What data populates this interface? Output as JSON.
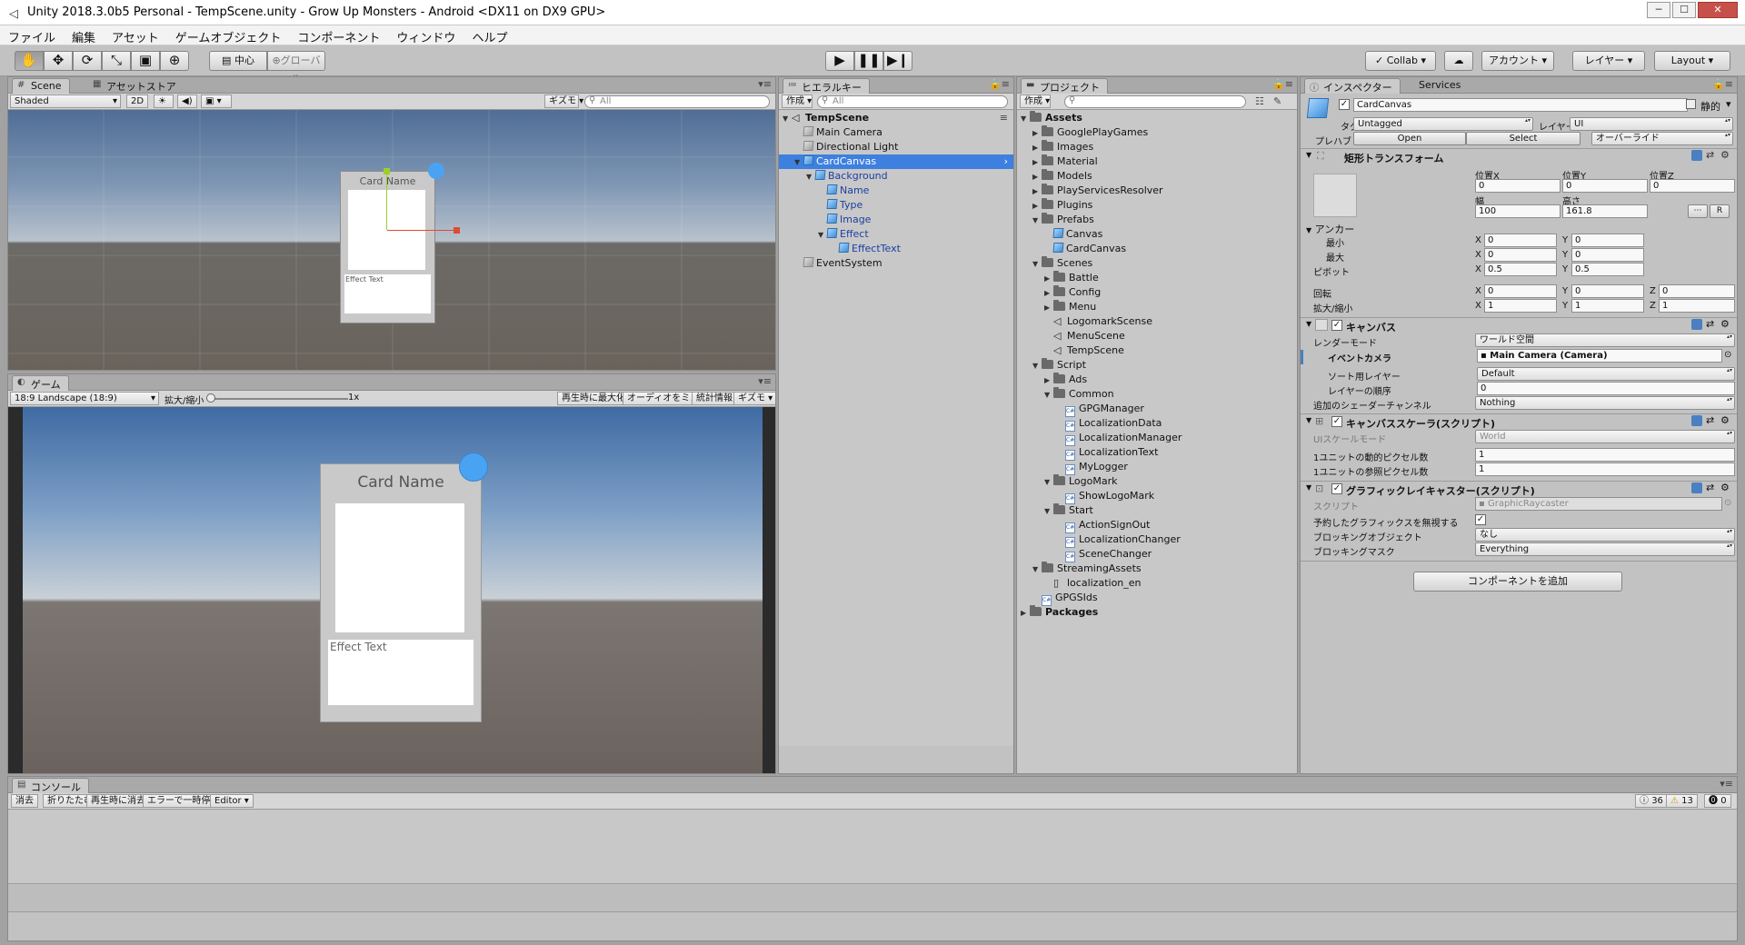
{
  "window": {
    "title": "Unity 2018.3.0b5 Personal - TempScene.unity - Grow Up Monsters - Android <DX11 on DX9 GPU>",
    "min": "─",
    "max": "☐",
    "close": "✕"
  },
  "menu": [
    "ファイル",
    "編集",
    "アセット",
    "ゲームオブジェクト",
    "コンポーネント",
    "ウィンドウ",
    "ヘルプ"
  ],
  "toolbar": {
    "pivot": "中心",
    "space": "グローバル",
    "collab": "Collab",
    "account": "アカウント",
    "layers": "レイヤー",
    "layout": "Layout"
  },
  "scene": {
    "tab": "Scene",
    "store_tab": "アセットストア",
    "shading": "Shaded",
    "mode2d": "2D",
    "gizmos": "ギズモ",
    "search": "All",
    "card_name": "Card Name",
    "effect_text": "Effect Text"
  },
  "game": {
    "tab": "ゲーム",
    "aspect": "18:9 Landscape (18:9)",
    "scale_label": "拡大/縮小",
    "scale_value": "1x",
    "scale_fraction": 0.0,
    "buttons": [
      "再生時に最大化",
      "オーディオをミュート",
      "統計情報",
      "ギズモ"
    ],
    "card_name": "Card Name",
    "effect_text": "Effect Text"
  },
  "hierarchy": {
    "tab": "ヒエラルキー",
    "create": "作成",
    "search": "All",
    "scene": "TempScene",
    "items": [
      {
        "name": "Main Camera",
        "depth": 1,
        "sel": false,
        "blue": false,
        "exp": ""
      },
      {
        "name": "Directional Light",
        "depth": 1,
        "sel": false,
        "blue": false,
        "exp": ""
      },
      {
        "name": "CardCanvas",
        "depth": 1,
        "sel": true,
        "blue": true,
        "exp": "▼"
      },
      {
        "name": "Background",
        "depth": 2,
        "sel": false,
        "blue": true,
        "exp": "▼"
      },
      {
        "name": "Name",
        "depth": 3,
        "sel": false,
        "blue": true,
        "exp": ""
      },
      {
        "name": "Type",
        "depth": 3,
        "sel": false,
        "blue": true,
        "exp": ""
      },
      {
        "name": "Image",
        "depth": 3,
        "sel": false,
        "blue": true,
        "exp": ""
      },
      {
        "name": "Effect",
        "depth": 3,
        "sel": false,
        "blue": true,
        "exp": "▼"
      },
      {
        "name": "EffectText",
        "depth": 4,
        "sel": false,
        "blue": true,
        "exp": ""
      },
      {
        "name": "EventSystem",
        "depth": 1,
        "sel": false,
        "blue": false,
        "exp": ""
      }
    ]
  },
  "project": {
    "tab": "プロジェクト",
    "create": "作成",
    "items": [
      {
        "name": "Assets",
        "depth": 0,
        "type": "folder",
        "exp": "▼",
        "bold": true
      },
      {
        "name": "GooglePlayGames",
        "depth": 1,
        "type": "folder",
        "exp": "▶"
      },
      {
        "name": "Images",
        "depth": 1,
        "type": "folder",
        "exp": "▶"
      },
      {
        "name": "Material",
        "depth": 1,
        "type": "folder",
        "exp": "▶"
      },
      {
        "name": "Models",
        "depth": 1,
        "type": "folder",
        "exp": "▶"
      },
      {
        "name": "PlayServicesResolver",
        "depth": 1,
        "type": "folder",
        "exp": "▶"
      },
      {
        "name": "Plugins",
        "depth": 1,
        "type": "folder",
        "exp": "▶"
      },
      {
        "name": "Prefabs",
        "depth": 1,
        "type": "folder",
        "exp": "▼"
      },
      {
        "name": "Canvas",
        "depth": 2,
        "type": "prefab",
        "exp": ""
      },
      {
        "name": "CardCanvas",
        "depth": 2,
        "type": "prefab",
        "exp": ""
      },
      {
        "name": "Scenes",
        "depth": 1,
        "type": "folder",
        "exp": "▼"
      },
      {
        "name": "Battle",
        "depth": 2,
        "type": "folder",
        "exp": "▶"
      },
      {
        "name": "Config",
        "depth": 2,
        "type": "folder",
        "exp": "▶"
      },
      {
        "name": "Menu",
        "depth": 2,
        "type": "folder",
        "exp": "▶"
      },
      {
        "name": "LogomarkScense",
        "depth": 2,
        "type": "scene",
        "exp": ""
      },
      {
        "name": "MenuScene",
        "depth": 2,
        "type": "scene",
        "exp": ""
      },
      {
        "name": "TempScene",
        "depth": 2,
        "type": "scene",
        "exp": ""
      },
      {
        "name": "Script",
        "depth": 1,
        "type": "folder",
        "exp": "▼"
      },
      {
        "name": "Ads",
        "depth": 2,
        "type": "folder",
        "exp": "▶"
      },
      {
        "name": "Common",
        "depth": 2,
        "type": "folder",
        "exp": "▼"
      },
      {
        "name": "GPGManager",
        "depth": 3,
        "type": "cs",
        "exp": ""
      },
      {
        "name": "LocalizationData",
        "depth": 3,
        "type": "cs",
        "exp": ""
      },
      {
        "name": "LocalizationManager",
        "depth": 3,
        "type": "cs",
        "exp": ""
      },
      {
        "name": "LocalizationText",
        "depth": 3,
        "type": "cs",
        "exp": ""
      },
      {
        "name": "MyLogger",
        "depth": 3,
        "type": "cs",
        "exp": ""
      },
      {
        "name": "LogoMark",
        "depth": 2,
        "type": "folder",
        "exp": "▼"
      },
      {
        "name": "ShowLogoMark",
        "depth": 3,
        "type": "cs",
        "exp": ""
      },
      {
        "name": "Start",
        "depth": 2,
        "type": "folder",
        "exp": "▼"
      },
      {
        "name": "ActionSignOut",
        "depth": 3,
        "type": "cs",
        "exp": ""
      },
      {
        "name": "LocalizationChanger",
        "depth": 3,
        "type": "cs",
        "exp": ""
      },
      {
        "name": "SceneChanger",
        "depth": 3,
        "type": "cs",
        "exp": ""
      },
      {
        "name": "StreamingAssets",
        "depth": 1,
        "type": "folder",
        "exp": "▼"
      },
      {
        "name": "localization_en",
        "depth": 2,
        "type": "file",
        "exp": ""
      },
      {
        "name": "GPGSIds",
        "depth": 1,
        "type": "cs",
        "exp": ""
      },
      {
        "name": "Packages",
        "depth": 0,
        "type": "folder",
        "exp": "▶",
        "bold": true
      }
    ]
  },
  "inspector": {
    "tab": "インスペクター",
    "services_tab": "Services",
    "object_name": "CardCanvas",
    "static": "静的",
    "tag_label": "タグ",
    "tag": "Untagged",
    "layer_label": "レイヤー",
    "layer": "UI",
    "prefab_label": "プレハブ",
    "open": "Open",
    "select": "Select",
    "overrides": "オーバーライド",
    "rect": {
      "title": "矩形トランスフォーム",
      "posx_l": "位置X",
      "posy_l": "位置Y",
      "posz_l": "位置Z",
      "posx": "0",
      "posy": "0",
      "posz": "0",
      "w_l": "幅",
      "h_l": "高さ",
      "w": "100",
      "h": "161.8",
      "r": "R",
      "anchor": "アンカー",
      "min": "最小",
      "max": "最大",
      "pivot": "ピボット",
      "minx": "0",
      "miny": "0",
      "maxx": "0",
      "maxy": "0",
      "pivx": "0.5",
      "pivy": "0.5",
      "rot": "回転",
      "scale": "拡大/縮小",
      "rx": "0",
      "ry": "0",
      "rz": "0",
      "sx": "1",
      "sy": "1",
      "sz": "1",
      "X": "X",
      "Y": "Y",
      "Z": "Z"
    },
    "canvas": {
      "title": "キャンバス",
      "render_mode_l": "レンダーモード",
      "render_mode": "ワールド空間",
      "event_camera_l": "イベントカメラ",
      "event_camera": "Main Camera (Camera)",
      "sort_layer_l": "ソート用レイヤー",
      "sort_layer": "Default",
      "order_l": "レイヤーの順序",
      "order": "0",
      "shader_l": "追加のシェーダーチャンネル",
      "shader": "Nothing"
    },
    "scaler": {
      "title": "キャンバススケーラ(スクリプト)",
      "mode_l": "UIスケールモード",
      "mode": "World",
      "dyn_l": "1ユニットの動的ピクセル数",
      "dyn": "1",
      "ref_l": "1ユニットの参照ピクセル数",
      "ref": "1"
    },
    "raycaster": {
      "title": "グラフィックレイキャスター(スクリプト)",
      "script_l": "スクリプト",
      "script": "GraphicRaycaster",
      "ignore_l": "予約したグラフィックスを無視する",
      "block_l": "ブロッキングオブジェクト",
      "block": "なし",
      "mask_l": "ブロッキングマスク",
      "mask": "Everything"
    },
    "add_component": "コンポーネントを追加"
  },
  "console": {
    "tab": "コンソール",
    "buttons": [
      "消去",
      "折りたたむ",
      "再生時に消去",
      "エラーで一時停止",
      "Editor"
    ],
    "info": "36",
    "warn": "13",
    "err": "0"
  },
  "colors": {
    "panel": "#c2c2c2",
    "selection": "#3d80df",
    "accent": "#4aa3f2"
  }
}
